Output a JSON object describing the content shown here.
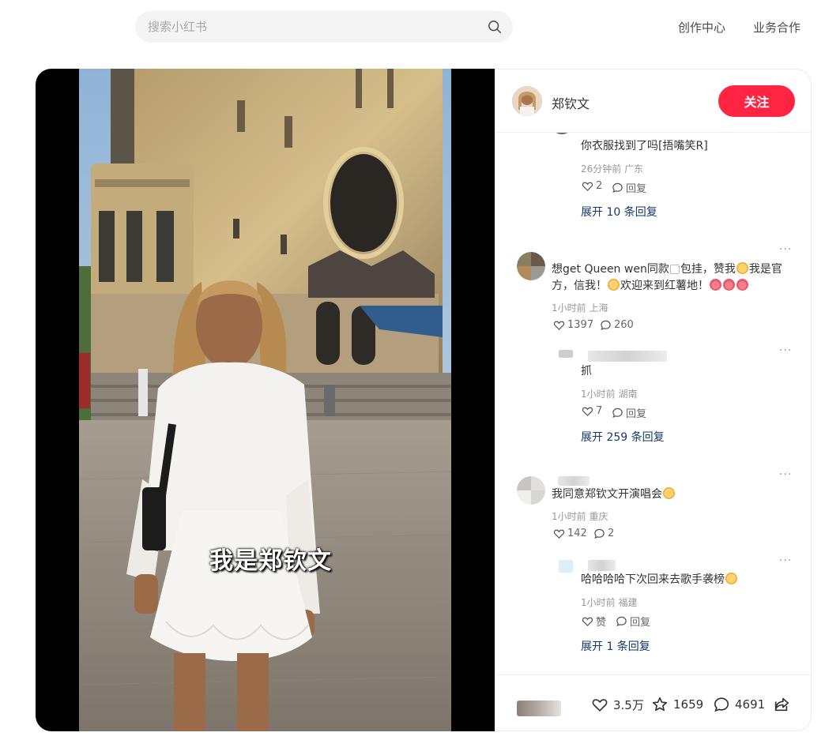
{
  "header": {
    "search_placeholder": "搜索小红书",
    "creator_center": "创作中心",
    "business": "业务合作"
  },
  "video": {
    "caption": "我是郑钦文"
  },
  "author": {
    "name": "郑钦文",
    "follow_label": "关注"
  },
  "comments": [
    {
      "text": "你衣服找到了吗[捂嘴笑R]",
      "meta": "26分钟前 广东",
      "likes": "2",
      "reply_label": "回复",
      "expand": "展开 10 条回复"
    },
    {
      "text_line1": "想get Queen wen同款",
      "text_line1b": "包挂，赞我",
      "text_line1c": "我是官",
      "text_line2": "方，信我！",
      "text_line2b": "欢迎来到红薯地！",
      "meta": "1小时前 上海",
      "likes": "1397",
      "replies": "260",
      "reply": {
        "text": "抓",
        "meta": "1小时前 湖南",
        "likes": "7",
        "reply_label": "回复"
      },
      "expand": "展开 259 条回复"
    },
    {
      "text": "我同意郑钦文开演唱会",
      "meta": "1小时前 重庆",
      "likes": "142",
      "replies": "2",
      "reply": {
        "text": "哈哈哈哈下次回来去歌手袭榜",
        "meta": "1小时前 福建",
        "likes": "赞",
        "reply_label": "回复"
      },
      "expand": "展开 1 条回复"
    }
  ],
  "bottom": {
    "likes": "3.5万",
    "stars": "1659",
    "comments": "4691"
  },
  "colors": {
    "accent": "#ff2442",
    "link": "#13386c"
  }
}
